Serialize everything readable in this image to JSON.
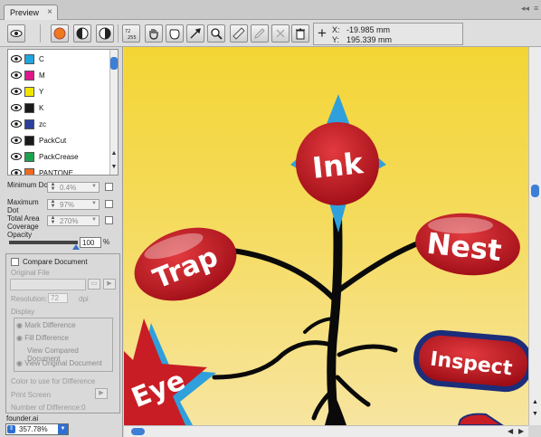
{
  "tab": {
    "title": "Preview",
    "close": "×"
  },
  "coords": {
    "x_label": "X:",
    "x_value": "-19.985 mm",
    "y_label": "Y:",
    "y_value": "195.339 mm"
  },
  "separations": [
    {
      "name": "C",
      "color": "#1fa5e0"
    },
    {
      "name": "M",
      "color": "#e0168c"
    },
    {
      "name": "Y",
      "color": "#f2e600"
    },
    {
      "name": "K",
      "color": "#1a1a1a"
    },
    {
      "name": "zc",
      "color": "#2a3f9e"
    },
    {
      "name": "PackCut",
      "color": "#1a1a1a"
    },
    {
      "name": "PackCrease",
      "color": "#19a44a"
    },
    {
      "name": "PANTONE ...",
      "color": "#ee6a22"
    }
  ],
  "settings": {
    "min_dot_label": "Minimum Dot",
    "min_dot_value": "0.4%",
    "max_dot_label": "Maximum Dot",
    "max_dot_value": "97%",
    "tac_label": "Total Area Coverage",
    "tac_value": "270%",
    "opacity_label": "Opacity",
    "opacity_value": "100",
    "opacity_unit": "%",
    "opacity_level": 1.0
  },
  "compare": {
    "checkbox_label": "Compare Document",
    "original_file_label": "Original File",
    "resolution_label": "Resolution:",
    "resolution_value": "72",
    "resolution_unit": "dpi",
    "display_label": "Display",
    "mark_difference": "Mark Difference",
    "fill_difference": "Fill Difference",
    "view_compared": "View Compared Document",
    "view_original": "View Original Document",
    "color_label": "Color to use for Difference",
    "print_screen": "Print Screen",
    "diff_count": "Number of Difference:0"
  },
  "footer": {
    "filename": "founder.ai",
    "zoom": "357.78%"
  },
  "artwork": {
    "labels": {
      "ink": "Ink",
      "trap": "Trap",
      "nest": "Nest",
      "eye": "Eye",
      "inspect": "Inspect"
    },
    "colors": {
      "red": "#c81d25",
      "blue": "#2fa0dc",
      "black": "#0a0a0a",
      "navy": "#1c2d7a"
    }
  }
}
